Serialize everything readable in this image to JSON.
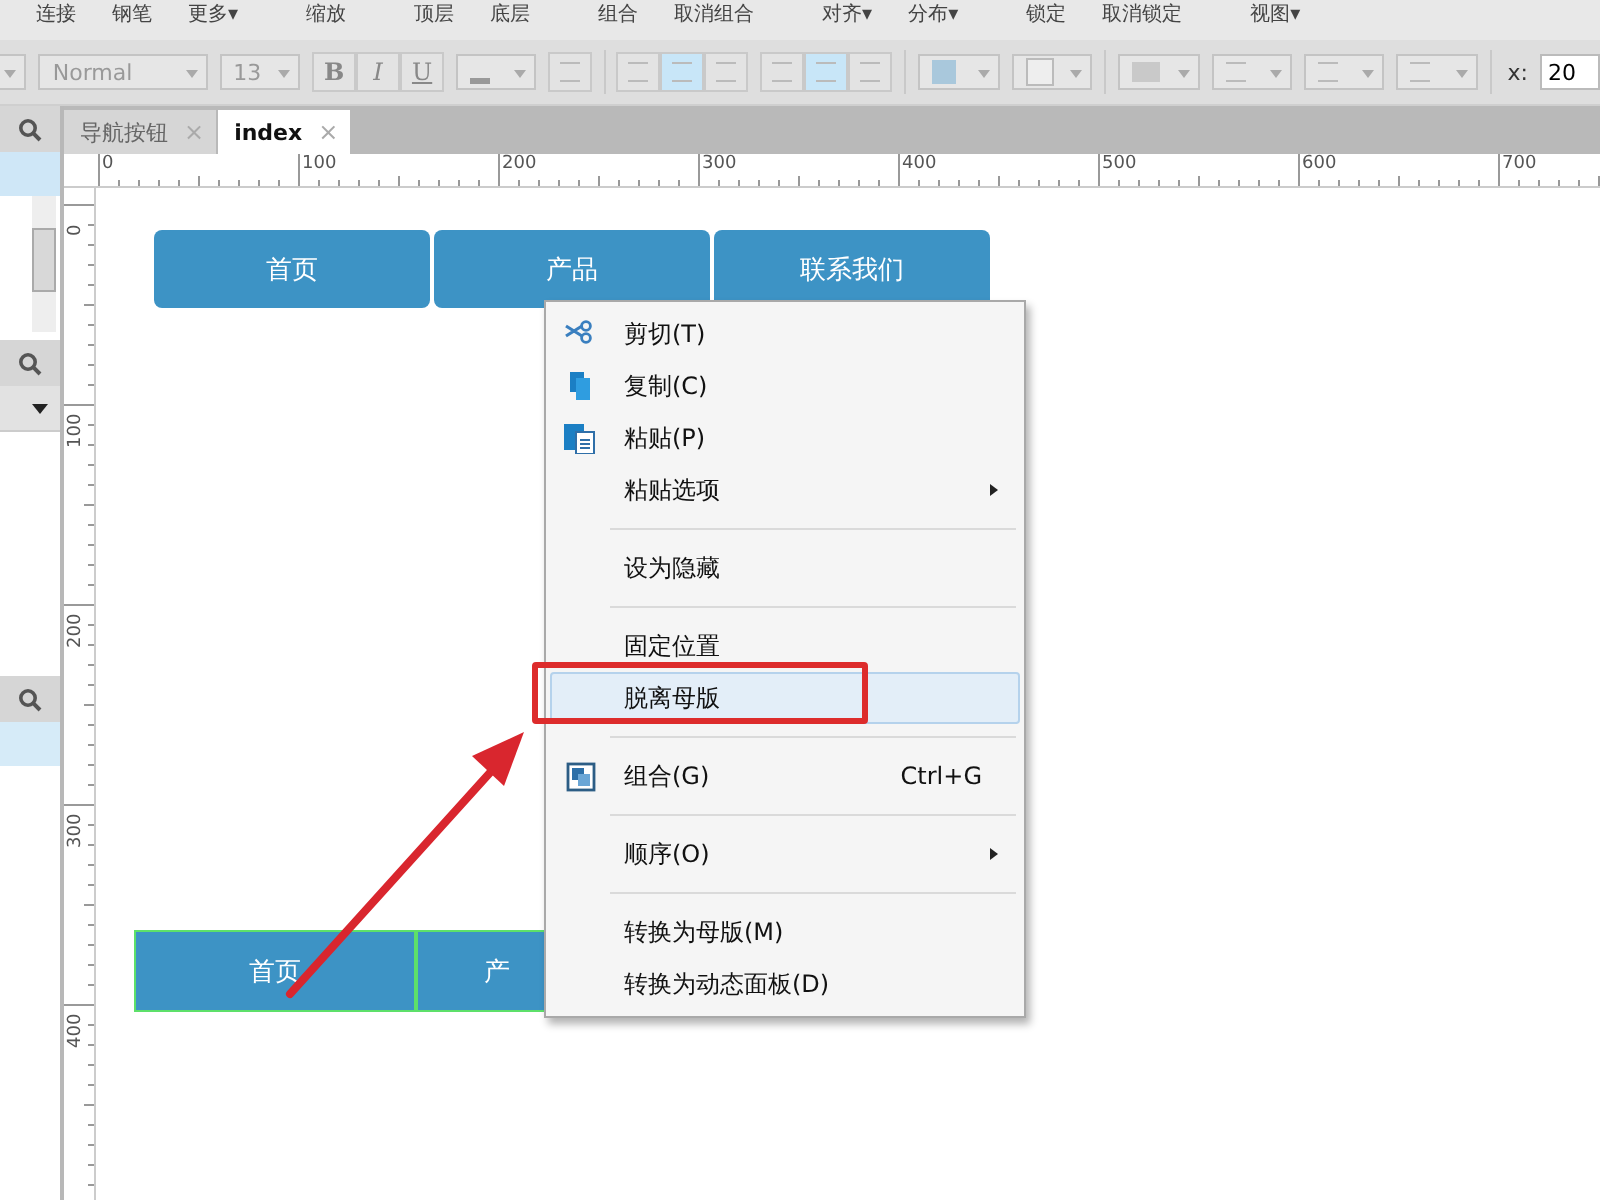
{
  "toolbar": {
    "groups": [
      [
        "连接",
        "钢笔",
        "更多▾"
      ],
      [
        "缩放"
      ],
      [
        "顶层",
        "底层"
      ],
      [
        "组合",
        "取消组合"
      ],
      [
        "对齐▾",
        "分布▾"
      ],
      [
        "锁定",
        "取消锁定"
      ],
      [
        "视图▾"
      ]
    ],
    "style_dropdown": "Normal",
    "size_dropdown": "13",
    "bold": "B",
    "italic": "I",
    "underline": "U",
    "align_buttons": [
      {
        "selected": false
      },
      {
        "selected": true
      },
      {
        "selected": false
      }
    ],
    "valign_buttons": [
      {
        "selected": false
      },
      {
        "selected": true
      },
      {
        "selected": false
      }
    ],
    "x_label": "x:",
    "x_value": "20"
  },
  "tabs": [
    {
      "label": "导航按钮",
      "selected": false,
      "close": "×"
    },
    {
      "label": "index",
      "selected": true,
      "close": "×"
    }
  ],
  "ruler": {
    "horizontal": [
      "0",
      "100",
      "200",
      "300",
      "400",
      "500",
      "600",
      "700"
    ],
    "vertical": [
      "0",
      "100",
      "200",
      "300",
      "400"
    ]
  },
  "canvas": {
    "top_nav": [
      "首页",
      "产品",
      "联系我们"
    ],
    "bottom_nav": [
      "首页",
      "产"
    ]
  },
  "context_menu": [
    {
      "kind": "item",
      "label": "剪切(T)",
      "submenu": false,
      "highlighted": false
    },
    {
      "kind": "item",
      "label": "复制(C)",
      "submenu": false,
      "highlighted": false
    },
    {
      "kind": "item",
      "label": "粘贴(P)",
      "submenu": false,
      "highlighted": false
    },
    {
      "kind": "item",
      "label": "粘贴选项",
      "submenu": true,
      "highlighted": false
    },
    {
      "kind": "separator"
    },
    {
      "kind": "item",
      "label": "设为隐藏",
      "submenu": false,
      "highlighted": false
    },
    {
      "kind": "separator"
    },
    {
      "kind": "item",
      "label": "固定位置",
      "submenu": false,
      "highlighted": false
    },
    {
      "kind": "item",
      "label": "脱离母版",
      "submenu": false,
      "highlighted": true
    },
    {
      "kind": "separator"
    },
    {
      "kind": "item",
      "label": "组合(G)",
      "shortcut": "Ctrl+G",
      "submenu": false,
      "highlighted": false
    },
    {
      "kind": "separator"
    },
    {
      "kind": "item",
      "label": "顺序(O)",
      "submenu": true,
      "highlighted": false
    },
    {
      "kind": "separator"
    },
    {
      "kind": "item",
      "label": "转换为母版(M)",
      "submenu": false,
      "highlighted": false
    },
    {
      "kind": "item",
      "label": "转换为动态面板(D)",
      "submenu": false,
      "highlighted": false
    }
  ]
}
